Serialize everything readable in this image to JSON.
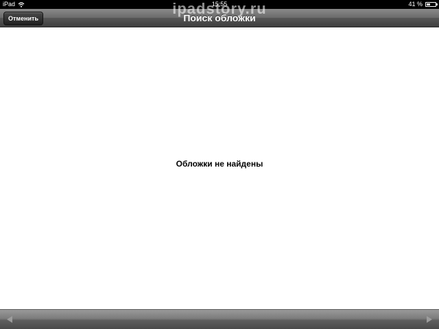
{
  "status_bar": {
    "carrier": "iPad",
    "time": "15:55",
    "battery": "41 %",
    "battery_level": 0.41
  },
  "watermark": "ipadstory.ru",
  "nav_bar": {
    "title": "Поиск обложки",
    "cancel_label": "Отменить"
  },
  "content": {
    "empty_message": "Обложки не найдены"
  },
  "toolbar": {
    "left_icon": "arrow-left-icon",
    "right_icon": "arrow-right-icon"
  },
  "colors": {
    "status_bg": "#000000",
    "nav_bg": "#6a6a6a",
    "content_bg": "#ffffff",
    "text": "#000000"
  }
}
